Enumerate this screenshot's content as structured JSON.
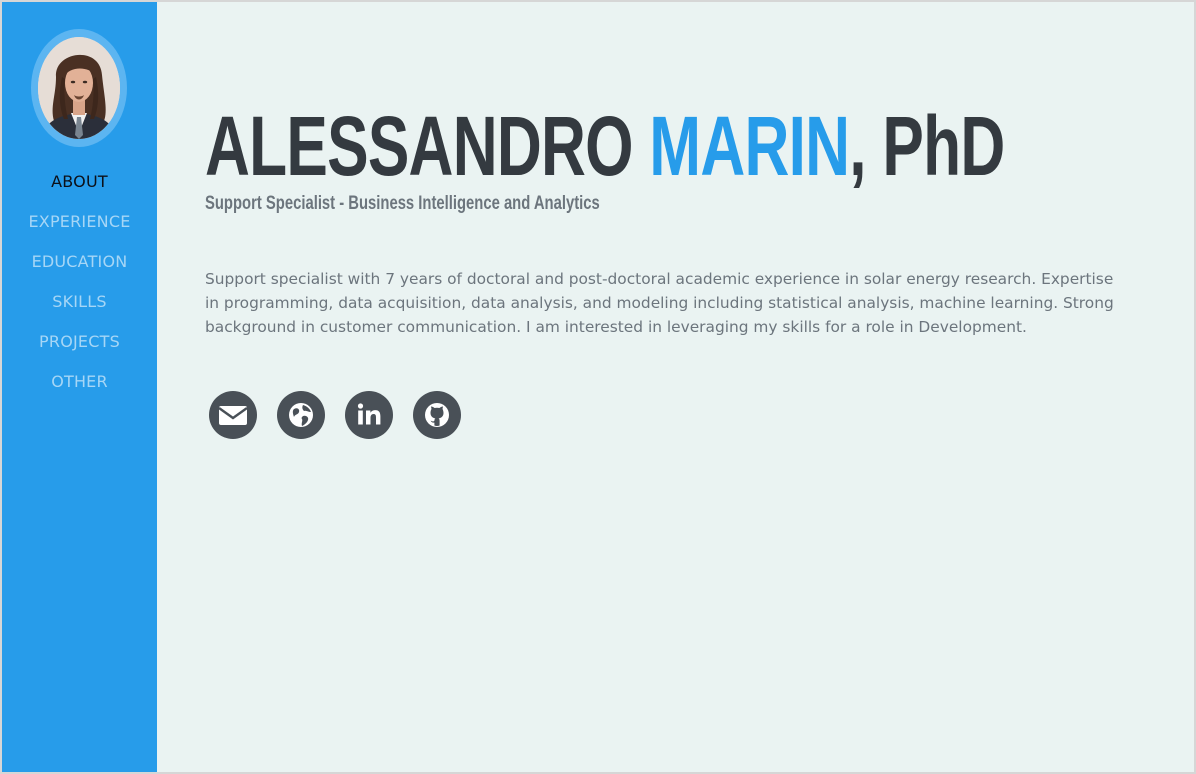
{
  "sidebar": {
    "avatar_alt": "profile photo",
    "nav": [
      {
        "label": "ABOUT",
        "active": true
      },
      {
        "label": "EXPERIENCE",
        "active": false
      },
      {
        "label": "EDUCATION",
        "active": false
      },
      {
        "label": "SKILLS",
        "active": false
      },
      {
        "label": "PROJECTS",
        "active": false
      },
      {
        "label": "OTHER",
        "active": false
      }
    ]
  },
  "about": {
    "first_name": "ALESSANDRO",
    "last_name": "MARIN",
    "suffix": ", PhD",
    "subtitle": "Support Specialist - Business Intelligence and Analytics",
    "summary": "Support specialist with 7 years of doctoral and post-doctoral academic experience in solar energy research. Expertise in programming, data acquisition, data analysis, and modeling including statistical analysis, machine learning. Strong background in customer communication. I am interested in leveraging my skills for a role in Development."
  },
  "social": [
    {
      "icon": "envelope-icon"
    },
    {
      "icon": "globe-icon"
    },
    {
      "icon": "linkedin-icon"
    },
    {
      "icon": "github-icon"
    }
  ],
  "colors": {
    "primary": "#279cea",
    "background": "#eaf3f2",
    "heading": "#343a40",
    "muted": "#6c757d",
    "icon_bg": "#495057"
  }
}
